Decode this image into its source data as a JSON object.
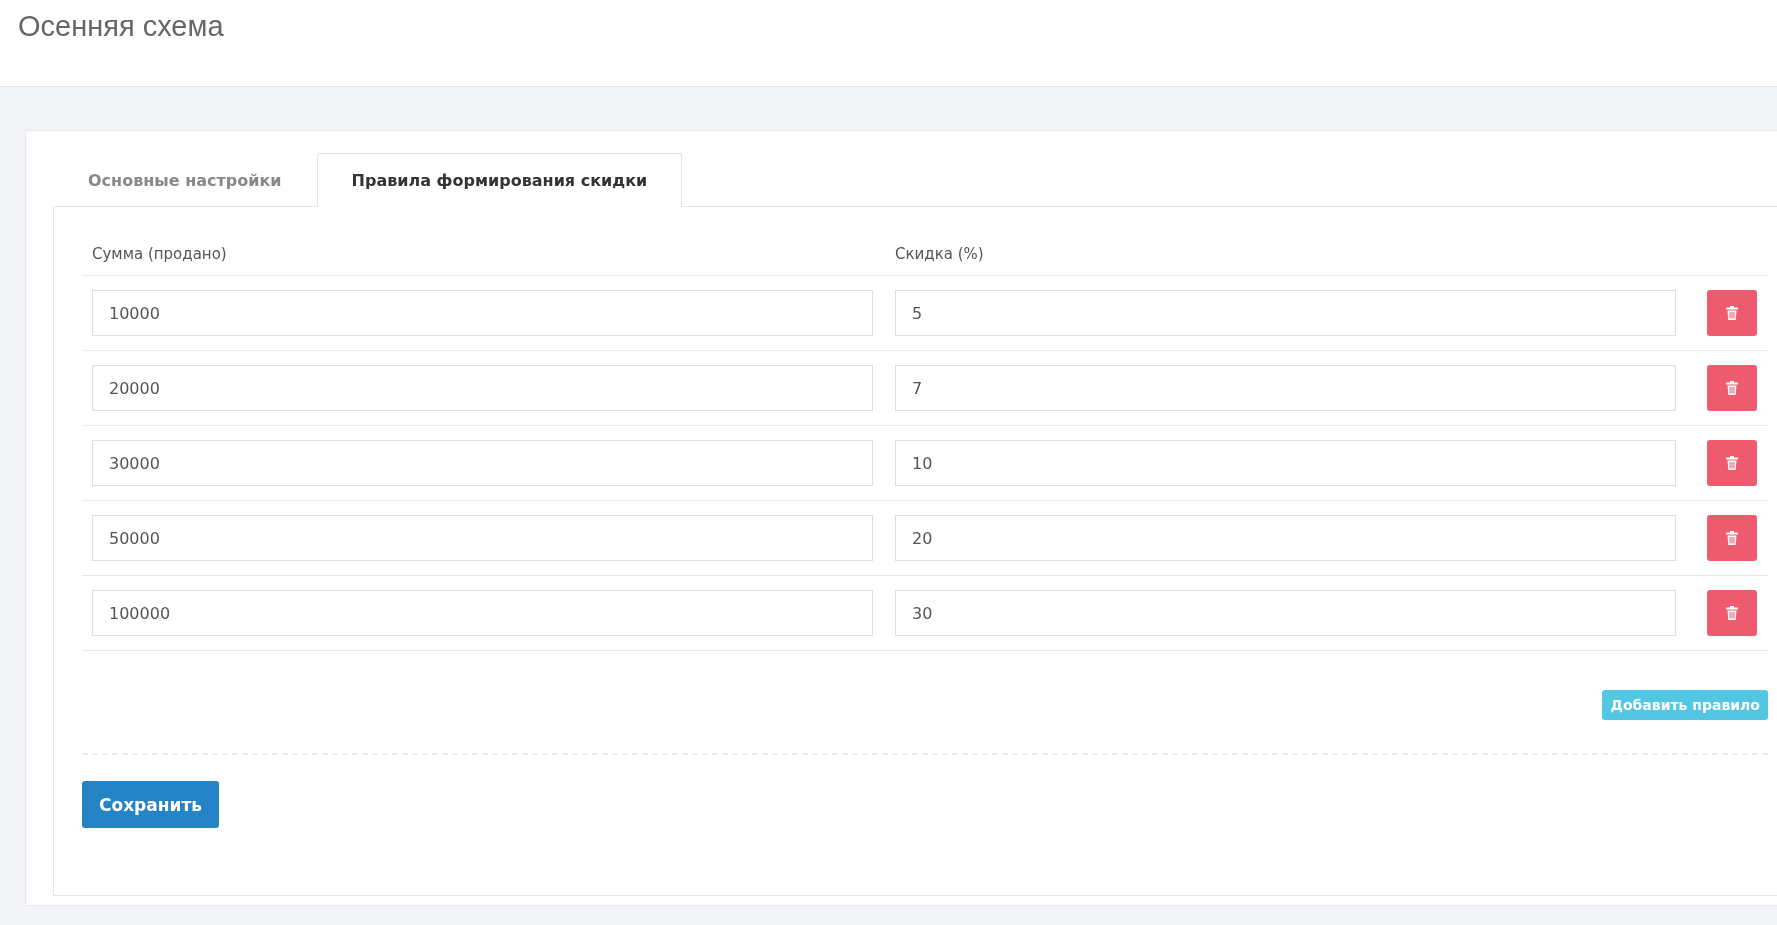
{
  "page_title": "Осенняя схема",
  "tabs": [
    {
      "label": "Основные настройки",
      "selected": false
    },
    {
      "label": "Правила формирования скидки",
      "selected": true
    }
  ],
  "table": {
    "columns": [
      "Сумма (продано)",
      "Скидка (%)"
    ],
    "rows": [
      {
        "amount": "10000",
        "discount": "5"
      },
      {
        "amount": "20000",
        "discount": "7"
      },
      {
        "amount": "30000",
        "discount": "10"
      },
      {
        "amount": "50000",
        "discount": "20"
      },
      {
        "amount": "100000",
        "discount": "30"
      }
    ]
  },
  "add_button": "Добавить правило",
  "save_button": "Сохранить"
}
